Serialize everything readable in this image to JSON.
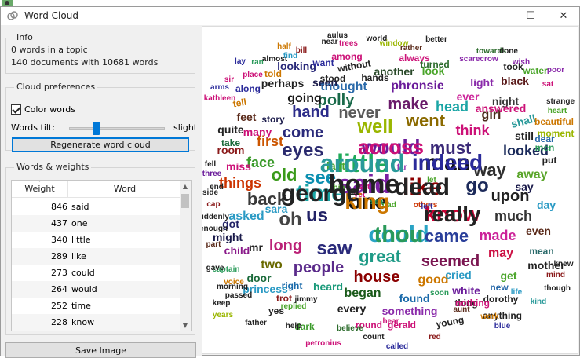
{
  "window": {
    "title": "Word Cloud",
    "controls": {
      "minimize": "—",
      "maximize": "☐",
      "close": "✕"
    }
  },
  "info": {
    "label": "Info",
    "words_in_topic": "0 words in a topic",
    "documents": "140 documents with 10681 words"
  },
  "cloud_preferences": {
    "label": "Cloud preferences",
    "color_words_label": "Color words",
    "color_words_checked": true,
    "words_tilt_label": "Words tilt:",
    "tilt_end_label": "slight",
    "regenerate_label": "Regenerate word cloud"
  },
  "words_weights": {
    "label": "Words & weights",
    "columns": [
      "Weight",
      "Word"
    ],
    "rows": [
      {
        "weight": "846",
        "word": "said"
      },
      {
        "weight": "437",
        "word": "one"
      },
      {
        "weight": "340",
        "word": "little"
      },
      {
        "weight": "289",
        "word": "like"
      },
      {
        "weight": "273",
        "word": "could"
      },
      {
        "weight": "264",
        "word": "would"
      },
      {
        "weight": "252",
        "word": "time"
      },
      {
        "weight": "228",
        "word": "know"
      }
    ]
  },
  "save_image_label": "Save Image",
  "cloud_words": [
    {
      "t": "said",
      "c": "#7b1fa2"
    },
    {
      "t": "little",
      "c": "#1faa59"
    },
    {
      "t": "one",
      "c": "#111111"
    },
    {
      "t": "like",
      "c": "#8e0000"
    },
    {
      "t": "could",
      "c": "#29a3c4"
    },
    {
      "t": "would",
      "c": "#6a1b9a"
    },
    {
      "t": "time",
      "c": "#1aa5a5"
    },
    {
      "t": "know",
      "c": "#cc0033"
    },
    {
      "t": "man",
      "c": "#111111"
    },
    {
      "t": "must",
      "c": "#3b2a78"
    },
    {
      "t": "eyes",
      "c": "#2a2a6e"
    },
    {
      "t": "see",
      "c": "#0b8fb0"
    },
    {
      "t": "old",
      "c": "#3a9a1a"
    },
    {
      "t": "went",
      "c": "#8b6a00"
    },
    {
      "t": "well",
      "c": "#9ab600"
    },
    {
      "t": "came",
      "c": "#2a3f9a"
    },
    {
      "t": "great",
      "c": "#1e9a86"
    },
    {
      "t": "seemed",
      "c": "#7a1550"
    },
    {
      "t": "us",
      "c": "#222266"
    },
    {
      "t": "oh",
      "c": "#444444"
    },
    {
      "t": "saw",
      "c": "#2a2a7a"
    },
    {
      "t": "way",
      "c": "#2f2f2f"
    },
    {
      "t": "go",
      "c": "#1c2a5a"
    },
    {
      "t": "upon",
      "c": "#222222"
    },
    {
      "t": "back",
      "c": "#3a3a3a"
    },
    {
      "t": "long",
      "c": "#bb2277"
    },
    {
      "t": "people",
      "c": "#5a2a8a"
    },
    {
      "t": "house",
      "c": "#8b0000"
    },
    {
      "t": "never",
      "c": "#5a5a5a"
    },
    {
      "t": "hand",
      "c": "#2d2d8a"
    },
    {
      "t": "come",
      "c": "#2a2a7a"
    },
    {
      "t": "polly",
      "c": "#1a6a4a"
    },
    {
      "t": "make",
      "c": "#6a1b6a"
    },
    {
      "t": "head",
      "c": "#1aa5a5"
    },
    {
      "t": "think",
      "c": "#cc1177"
    },
    {
      "t": "looked",
      "c": "#1a2a5a"
    },
    {
      "t": "made",
      "c": "#cc2299"
    },
    {
      "t": "much",
      "c": "#333333"
    },
    {
      "t": "things",
      "c": "#cc3300"
    },
    {
      "t": "face",
      "c": "#3a9a2a"
    },
    {
      "t": "first",
      "c": "#cc5500"
    },
    {
      "t": "thought",
      "c": "#2a6aaa"
    },
    {
      "t": "phronsie",
      "c": "#6a1b9a"
    },
    {
      "t": "good",
      "c": "#cc7700"
    },
    {
      "t": "began",
      "c": "#1a5a1a"
    },
    {
      "t": "two",
      "c": "#6a6a00"
    },
    {
      "t": "asked",
      "c": "#2a9ac4"
    },
    {
      "t": "got",
      "c": "#222266"
    },
    {
      "t": "going",
      "c": "#1a1a1a"
    },
    {
      "t": "may",
      "c": "#cc1144"
    },
    {
      "t": "girl",
      "c": "#4a2a1a"
    },
    {
      "t": "still",
      "c": "#222222"
    },
    {
      "t": "away",
      "c": "#5aa52a"
    },
    {
      "t": "say",
      "c": "#1a1a4a"
    },
    {
      "t": "mr",
      "c": "#222222"
    },
    {
      "t": "found",
      "c": "#1a6aaa"
    },
    {
      "t": "heard",
      "c": "#1a9a7a"
    },
    {
      "t": "ever",
      "c": "#cc2299"
    },
    {
      "t": "night",
      "c": "#3a3a3a"
    },
    {
      "t": "looking",
      "c": "#2a2a7a"
    },
    {
      "t": "another",
      "c": "#2a4a2a"
    },
    {
      "t": "perhaps",
      "c": "#222222"
    },
    {
      "t": "shall",
      "c": "#2a9a9a"
    },
    {
      "t": "quite",
      "c": "#222222"
    },
    {
      "t": "room",
      "c": "#8a1a1a"
    },
    {
      "t": "miss",
      "c": "#cc1177"
    },
    {
      "t": "last",
      "c": "#4aa52a"
    },
    {
      "t": "might",
      "c": "#1a1a4a"
    },
    {
      "t": "child",
      "c": "#8a1a8a"
    },
    {
      "t": "sara",
      "c": "#2a9ac4"
    },
    {
      "t": "even",
      "c": "#5a2a1a"
    },
    {
      "t": "mother",
      "c": "#222222"
    },
    {
      "t": "day",
      "c": "#2a9ac4"
    },
    {
      "t": "door",
      "c": "#1a6a3a"
    },
    {
      "t": "cried",
      "c": "#2a9ac4"
    },
    {
      "t": "get",
      "c": "#4aa52a"
    },
    {
      "t": "white",
      "c": "#6a1b9a"
    },
    {
      "t": "thing",
      "c": "#222222"
    },
    {
      "t": "new",
      "c": "#2a6aaa"
    },
    {
      "t": "dorothy",
      "c": "#222222"
    },
    {
      "t": "nothing",
      "c": "#cc1177"
    },
    {
      "t": "every",
      "c": "#222222"
    },
    {
      "t": "something",
      "c": "#8a2aaa"
    },
    {
      "t": "princess",
      "c": "#2a9ac4"
    },
    {
      "t": "right",
      "c": "#1a6aaa"
    },
    {
      "t": "trot",
      "c": "#8a1a1a"
    },
    {
      "t": "yes",
      "c": "#222222"
    },
    {
      "t": "dark",
      "c": "#3a9a2a"
    },
    {
      "t": "round",
      "c": "#cc1177"
    },
    {
      "t": "gerald",
      "c": "#cc1177"
    },
    {
      "t": "young",
      "c": "#222222"
    },
    {
      "t": "anything",
      "c": "#222222"
    },
    {
      "t": "answered",
      "c": "#cc1177"
    },
    {
      "t": "beautiful",
      "c": "#cc7700"
    },
    {
      "t": "moment",
      "c": "#9ab600"
    },
    {
      "t": "dear",
      "c": "#2a6aaa"
    },
    {
      "t": "men",
      "c": "#2a9a5a"
    },
    {
      "t": "put",
      "c": "#222222"
    },
    {
      "t": "feet",
      "c": "#5a2a1a"
    },
    {
      "t": "many",
      "c": "#cc1177"
    },
    {
      "t": "story",
      "c": "#1a1a4a"
    },
    {
      "t": "tell",
      "c": "#cc7700"
    },
    {
      "t": "take",
      "c": "#1a6a3a"
    },
    {
      "t": "along",
      "c": "#2a2a9a"
    },
    {
      "t": "seen",
      "c": "#1a1a4a"
    },
    {
      "t": "light",
      "c": "#8a2aaa"
    },
    {
      "t": "black",
      "c": "#5a1a1a"
    },
    {
      "t": "look",
      "c": "#4aa52a"
    },
    {
      "t": "hands",
      "c": "#222222"
    },
    {
      "t": "always",
      "c": "#cc1177"
    },
    {
      "t": "turned",
      "c": "#2a6a2a"
    },
    {
      "t": "took",
      "c": "#222222"
    },
    {
      "t": "water",
      "c": "#4aa52a"
    },
    {
      "t": "without",
      "c": "#222222"
    },
    {
      "t": "among",
      "c": "#cc1177"
    },
    {
      "t": "rather",
      "c": "#5a2a1a"
    },
    {
      "t": "stood",
      "c": "#222222"
    },
    {
      "t": "told",
      "c": "#cc7700"
    },
    {
      "t": "place",
      "c": "#cc1177"
    },
    {
      "t": "almost",
      "c": "#222222"
    },
    {
      "t": "find",
      "c": "#2a9ac4"
    },
    {
      "t": "bill",
      "c": "#8a1a1a"
    },
    {
      "t": "want",
      "c": "#2a2a9a"
    },
    {
      "t": "near",
      "c": "#222222"
    },
    {
      "t": "trees",
      "c": "#cc1177"
    },
    {
      "t": "world",
      "c": "#222222"
    },
    {
      "t": "better",
      "c": "#222222"
    },
    {
      "t": "scarecrow",
      "c": "#8a2aaa"
    },
    {
      "t": "towards",
      "c": "#2a6a2a"
    },
    {
      "t": "done",
      "c": "#222222"
    },
    {
      "t": "strange",
      "c": "#222222"
    },
    {
      "t": "heart",
      "c": "#4aa52a"
    },
    {
      "t": "mean",
      "c": "#2a6a6a"
    },
    {
      "t": "knew",
      "c": "#222222"
    },
    {
      "t": "mind",
      "c": "#8a1a1a"
    },
    {
      "t": "though",
      "c": "#222222"
    },
    {
      "t": "kind",
      "c": "#2a9a9a"
    },
    {
      "t": "life",
      "c": "#2a9ac4"
    },
    {
      "t": "soon",
      "c": "#2a9a5a"
    },
    {
      "t": "aunt",
      "c": "#5a2a1a"
    },
    {
      "t": "work",
      "c": "#cc7700"
    },
    {
      "t": "blue",
      "c": "#2a2a9a"
    },
    {
      "t": "red",
      "c": "#8a1a1a"
    },
    {
      "t": "hear",
      "c": "#cc1177"
    },
    {
      "t": "count",
      "c": "#222222"
    },
    {
      "t": "called",
      "c": "#2a2a9a"
    },
    {
      "t": "petronius",
      "c": "#cc1177"
    },
    {
      "t": "believe",
      "c": "#2a6a2a"
    },
    {
      "t": "help",
      "c": "#222222"
    },
    {
      "t": "father",
      "c": "#222222"
    },
    {
      "t": "years",
      "c": "#9ab600"
    },
    {
      "t": "replied",
      "c": "#4aa52a"
    },
    {
      "t": "jimmy",
      "c": "#222222"
    },
    {
      "t": "keep",
      "c": "#222222"
    },
    {
      "t": "passed",
      "c": "#222222"
    },
    {
      "t": "voice",
      "c": "#cc7700"
    },
    {
      "t": "captain",
      "c": "#2a9a5a"
    },
    {
      "t": "morning",
      "c": "#222222"
    },
    {
      "t": "gave",
      "c": "#222222"
    },
    {
      "t": "part",
      "c": "#5a2a1a"
    },
    {
      "t": "enough",
      "c": "#222222"
    },
    {
      "t": "suddenly",
      "c": "#222222"
    },
    {
      "t": "three",
      "c": "#6a1b9a"
    },
    {
      "t": "fell",
      "c": "#222222"
    },
    {
      "t": "side",
      "c": "#222222"
    },
    {
      "t": "cap",
      "c": "#8a1a1a"
    },
    {
      "t": "end",
      "c": "#222222"
    },
    {
      "t": "give",
      "c": "#222222"
    },
    {
      "t": "yet",
      "c": "#cc1177"
    },
    {
      "t": "others",
      "c": "#cc3300"
    },
    {
      "t": "far",
      "c": "#8a2aaa"
    },
    {
      "t": "set",
      "c": "#cc1177"
    },
    {
      "t": "big",
      "c": "#4aa52a"
    },
    {
      "t": "let",
      "c": "#4aa52a"
    },
    {
      "t": "left",
      "c": "#2a2a9a"
    },
    {
      "t": "road",
      "c": "#4aa52a"
    },
    {
      "t": "sea",
      "c": "#2a9a5a"
    },
    {
      "t": "sat",
      "c": "#cc1177"
    },
    {
      "t": "poor",
      "c": "#8a2aaa"
    },
    {
      "t": "wish",
      "c": "#8a2aaa"
    },
    {
      "t": "arms",
      "c": "#2a2a9a"
    },
    {
      "t": "kathleen",
      "c": "#cc1177"
    },
    {
      "t": "sir",
      "c": "#cc1177"
    },
    {
      "t": "lay",
      "c": "#2a2a9a"
    },
    {
      "t": "ran",
      "c": "#2a9a5a"
    },
    {
      "t": "half",
      "c": "#cc7700"
    },
    {
      "t": "aulus",
      "c": "#222222"
    },
    {
      "t": "window",
      "c": "#9ab600"
    },
    {
      "t": "home",
      "c": "#222222"
    },
    {
      "t": "around",
      "c": "#2a9a9a"
    },
    {
      "t": "king",
      "c": "#cc7700"
    },
    {
      "t": "dead",
      "c": "#222222"
    },
    {
      "t": "thou",
      "c": "#2a9a5a"
    },
    {
      "t": "across",
      "c": "#cc1177"
    },
    {
      "t": "george",
      "c": "#222222"
    },
    {
      "t": "really",
      "c": "#222222"
    },
    {
      "t": "indeed",
      "c": "#2a2a9a"
    }
  ]
}
